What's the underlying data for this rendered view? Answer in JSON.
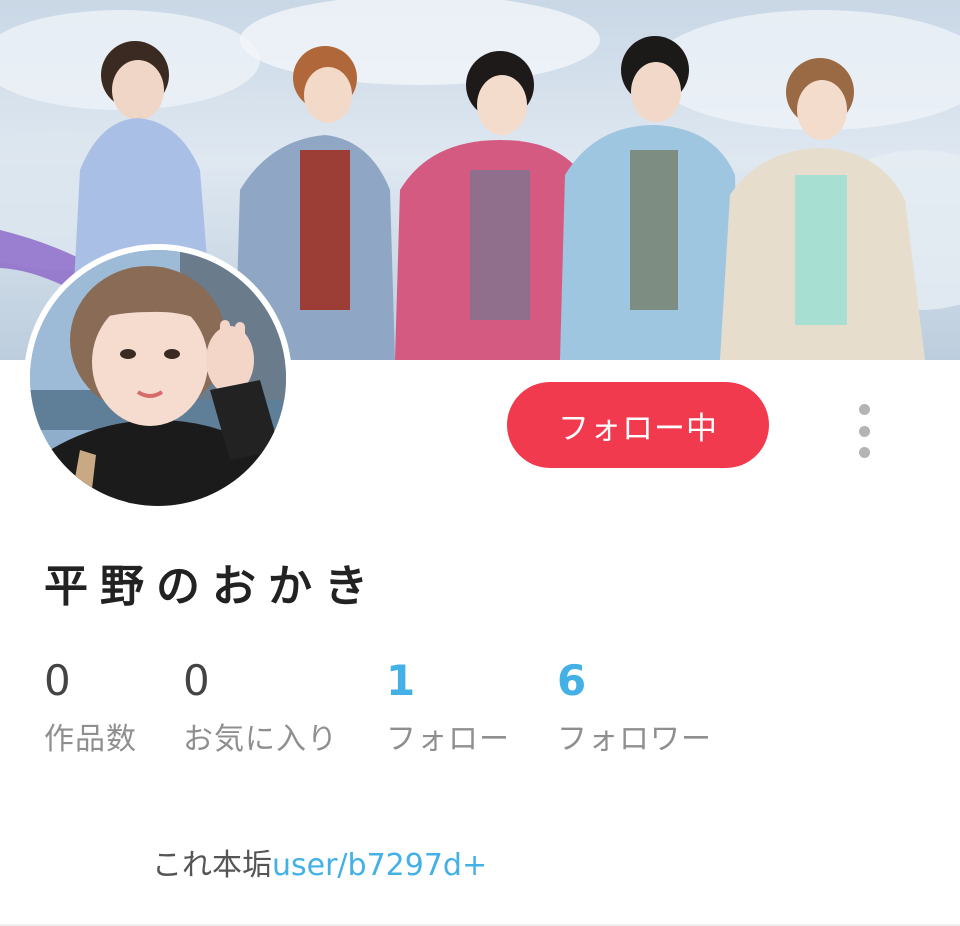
{
  "header": {
    "follow_button_label": "フォロー中",
    "more_icon": "more-vertical-icon"
  },
  "profile": {
    "name": "平野のおかき",
    "stats": [
      {
        "value": "0",
        "label": "作品数"
      },
      {
        "value": "0",
        "label": "お気に入り"
      },
      {
        "value": "1",
        "label": "フォロー"
      },
      {
        "value": "6",
        "label": "フォロワー"
      }
    ],
    "bio_text": "これ本垢",
    "bio_link": "user/b7297d+"
  },
  "colors": {
    "accent": "#f13a4e",
    "link": "#44b1e6"
  }
}
